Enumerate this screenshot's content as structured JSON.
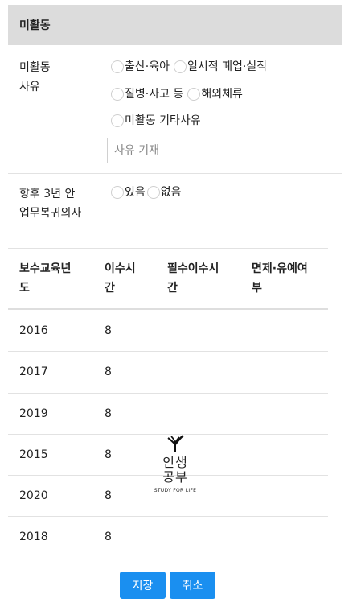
{
  "section": {
    "title": "미활동"
  },
  "inactive_reason": {
    "label_line1": "미활동",
    "label_line2": "사유",
    "options": [
      "출산·육아",
      "일시적 폐업·실직",
      "질병·사고 등",
      "해외체류",
      "미활동 기타사유"
    ],
    "input_placeholder": "사유 기재",
    "input_value": ""
  },
  "return_intent": {
    "label_line1": "향후 3년 안",
    "label_line2": "업무복귀의사",
    "options": [
      "있음",
      "없음"
    ]
  },
  "table": {
    "headers": [
      [
        "보수교육년",
        "도"
      ],
      [
        "이수시",
        "간"
      ],
      [
        "필수이수시",
        "간"
      ],
      [
        "면제·유예여",
        "부"
      ]
    ],
    "rows": [
      {
        "year": "2016",
        "hours": "8"
      },
      {
        "year": "2017",
        "hours": "8"
      },
      {
        "year": "2019",
        "hours": "8"
      },
      {
        "year": "2015",
        "hours": "8"
      },
      {
        "year": "2020",
        "hours": "8"
      },
      {
        "year": "2018",
        "hours": "8"
      }
    ]
  },
  "watermark": {
    "line1": "인생",
    "line2": "공부",
    "sub": "STUDY FOR LIFE",
    "icon": "sprout-icon"
  },
  "buttons": {
    "save": "저장",
    "cancel": "취소"
  },
  "colors": {
    "header_bg": "#dcdcdc",
    "button": "#1a8ff0"
  }
}
